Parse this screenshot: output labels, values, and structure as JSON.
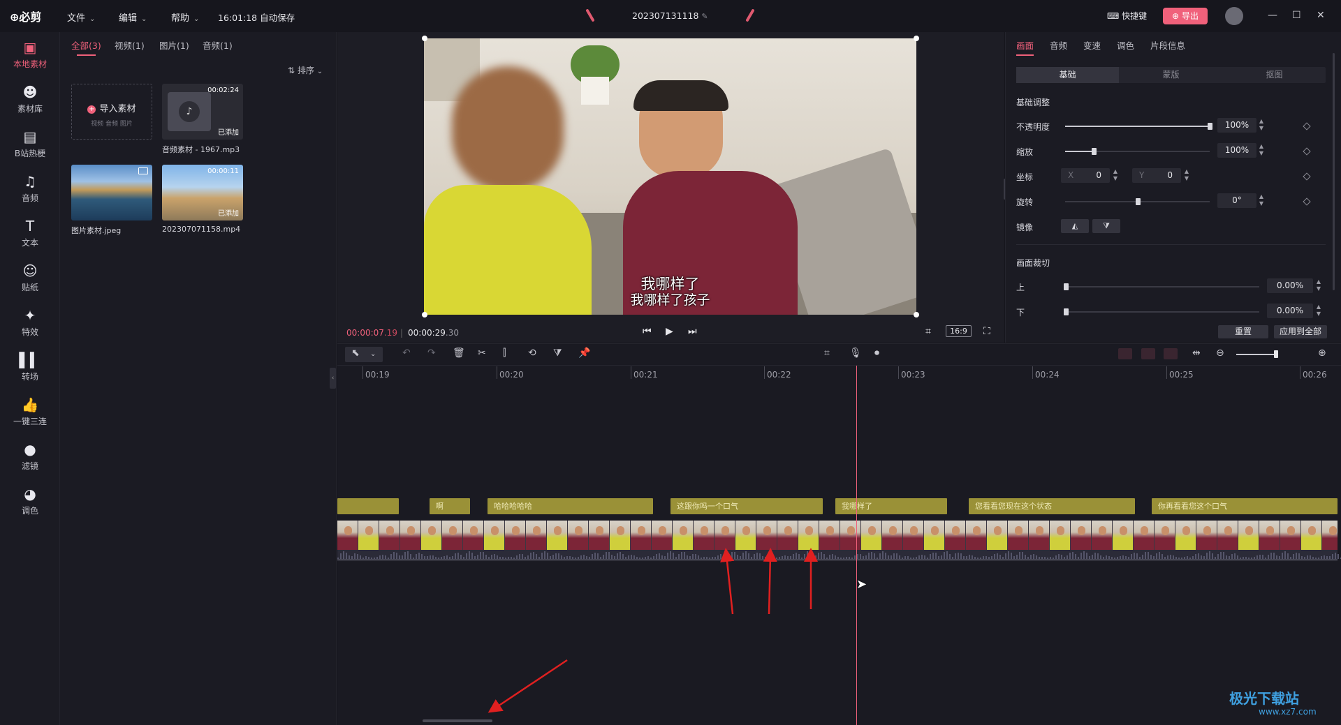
{
  "titlebar": {
    "logo": "必剪",
    "menus": [
      {
        "label": "文件"
      },
      {
        "label": "编辑"
      },
      {
        "label": "帮助"
      }
    ],
    "autosave": "16:01:18 自动保存",
    "project_title": "202307131118",
    "shortcut_label": "快捷键",
    "export_label": "导出",
    "window_controls": [
      "minimize-icon",
      "maximize-icon",
      "close-icon"
    ]
  },
  "leftnav": {
    "items": [
      {
        "label": "本地素材",
        "icon": "folder-icon"
      },
      {
        "label": "素材库",
        "icon": "library-icon"
      },
      {
        "label": "B站热梗",
        "icon": "bilibili-icon"
      },
      {
        "label": "音频",
        "icon": "music-icon"
      },
      {
        "label": "文本",
        "icon": "text-icon"
      },
      {
        "label": "贴纸",
        "icon": "sticker-icon"
      },
      {
        "label": "特效",
        "icon": "effects-icon"
      },
      {
        "label": "转场",
        "icon": "transition-icon"
      },
      {
        "label": "一键三连",
        "icon": "thumbs-up-icon"
      },
      {
        "label": "滤镜",
        "icon": "filter-icon"
      },
      {
        "label": "调色",
        "icon": "palette-icon"
      }
    ],
    "active_index": 0
  },
  "media": {
    "tabs": [
      {
        "label": "全部(3)"
      },
      {
        "label": "视频(1)"
      },
      {
        "label": "图片(1)"
      },
      {
        "label": "音频(1)"
      }
    ],
    "sort_label": "排序",
    "import": {
      "label": "导入素材",
      "sub": "视频  音频  图片"
    },
    "items": [
      {
        "name": "音频素材 - 1967.mp3",
        "duration": "00:02:24",
        "status": "已添加"
      },
      {
        "name": "图片素材.jpeg",
        "duration": "",
        "status": ""
      },
      {
        "name": "202307071158.mp4",
        "duration": "00:00:11",
        "status": "已添加"
      }
    ]
  },
  "preview": {
    "subtitle_line1": "我哪样了",
    "subtitle_line2": "我哪样了孩子",
    "current_time_a": "00:00:07",
    "current_time_b": ".19",
    "total_time_a": "00:00:29",
    "total_time_b": ".30",
    "ratio": "16:9"
  },
  "inspector": {
    "tabs": [
      {
        "label": "画面"
      },
      {
        "label": "音频"
      },
      {
        "label": "变速"
      },
      {
        "label": "调色"
      },
      {
        "label": "片段信息"
      }
    ],
    "subtabs": [
      {
        "label": "基础"
      },
      {
        "label": "蒙版"
      },
      {
        "label": "抠图"
      }
    ],
    "section_basic": "基础调整",
    "opacity": {
      "label": "不透明度",
      "value": "100%",
      "level": 1.0
    },
    "scale": {
      "label": "缩放",
      "value": "100%",
      "level": 0.2
    },
    "position": {
      "label": "坐标",
      "x_key": "X",
      "x": "0",
      "y_key": "Y",
      "y": "0"
    },
    "rotation": {
      "label": "旋转",
      "value": "0°",
      "level": 0.5
    },
    "mirror": {
      "label": "镜像"
    },
    "section_crop": "画面裁切",
    "crop_top": {
      "label": "上",
      "value": "0.00%"
    },
    "crop_bottom": {
      "label": "下",
      "value": "0.00%"
    },
    "reset_label": "重置",
    "apply_all_label": "应用到全部"
  },
  "timeline": {
    "ticks": [
      "00:19",
      "00:20",
      "00:21",
      "00:22",
      "00:23",
      "00:24",
      "00:25",
      "00:26"
    ],
    "subtitle_clips": [
      {
        "text": ""
      },
      {
        "text": "啊"
      },
      {
        "text": "哈哈哈哈哈"
      },
      {
        "text": "这跟你吗一个口气"
      },
      {
        "text": "我哪样了"
      },
      {
        "text": "您看看您现在这个状态"
      },
      {
        "text": "你再看看您这个口气"
      }
    ]
  },
  "watermark": {
    "line1": "极光下载站",
    "line2": "www.xz7.com"
  },
  "colors": {
    "accent": "#f0617b",
    "subtitle_clip": "#9a9137",
    "background": "#15151c"
  }
}
